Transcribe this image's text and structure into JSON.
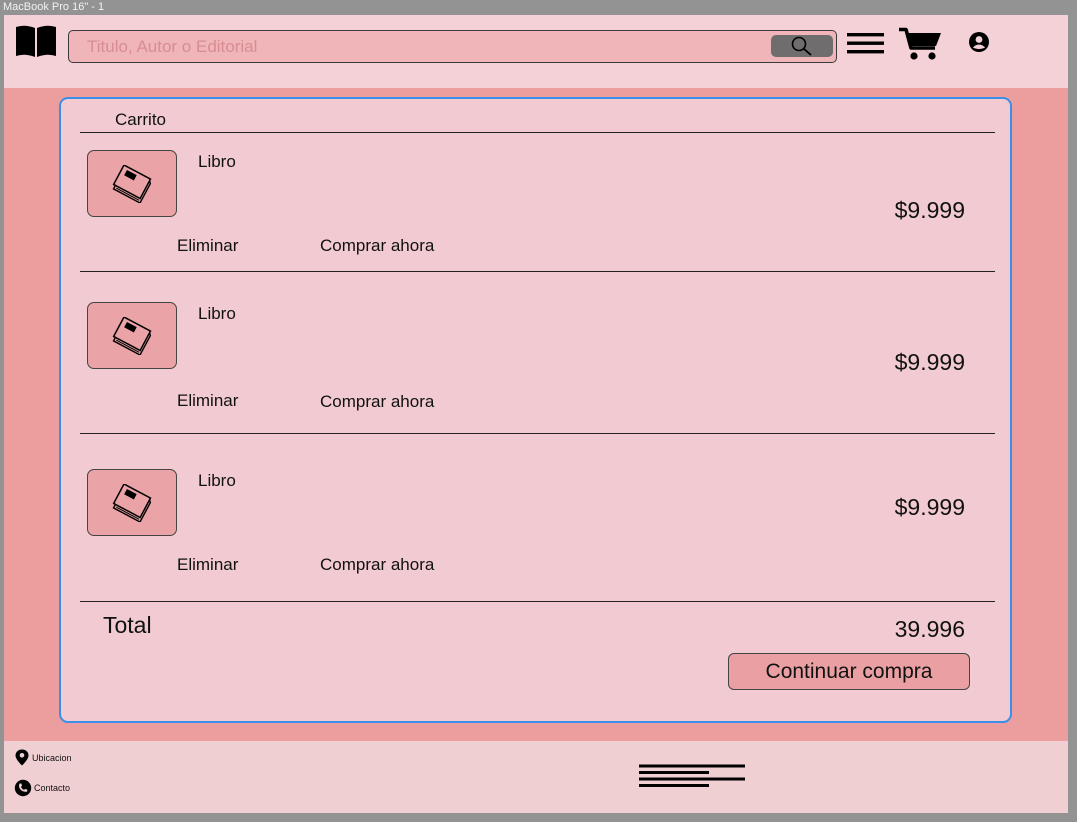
{
  "frame": {
    "label": "MacBook Pro 16\" - 1"
  },
  "search": {
    "placeholder": "Titulo, Autor o Editorial"
  },
  "cart": {
    "title": "Carrito",
    "items": [
      {
        "name": "Libro",
        "price": "$9.999",
        "delete_label": "Eliminar",
        "buy_label": "Comprar ahora"
      },
      {
        "name": "Libro",
        "price": "$9.999",
        "delete_label": "Eliminar",
        "buy_label": "Comprar ahora"
      },
      {
        "name": "Libro",
        "price": "$9.999",
        "delete_label": "Eliminar",
        "buy_label": "Comprar ahora"
      }
    ],
    "total_label": "Total",
    "total_value": "39.996",
    "continue_label": "Continuar compra"
  },
  "footer": {
    "location_label": "Ubicacion",
    "contact_label": "Contacto"
  },
  "icons": {
    "logo": "open-book-icon",
    "search": "search-icon",
    "menu": "menu-icon",
    "cart": "cart-icon",
    "user": "user-icon",
    "item_thumb": "book-icon",
    "location": "location-pin-icon",
    "contact": "phone-icon"
  },
  "colors": {
    "background": "#ec9e9e",
    "header": "#f3d1d6",
    "card": "#f1cbd1",
    "card_border": "#3b8fe8",
    "search_field": "#efb5b8",
    "button": "#eaa0a3"
  }
}
